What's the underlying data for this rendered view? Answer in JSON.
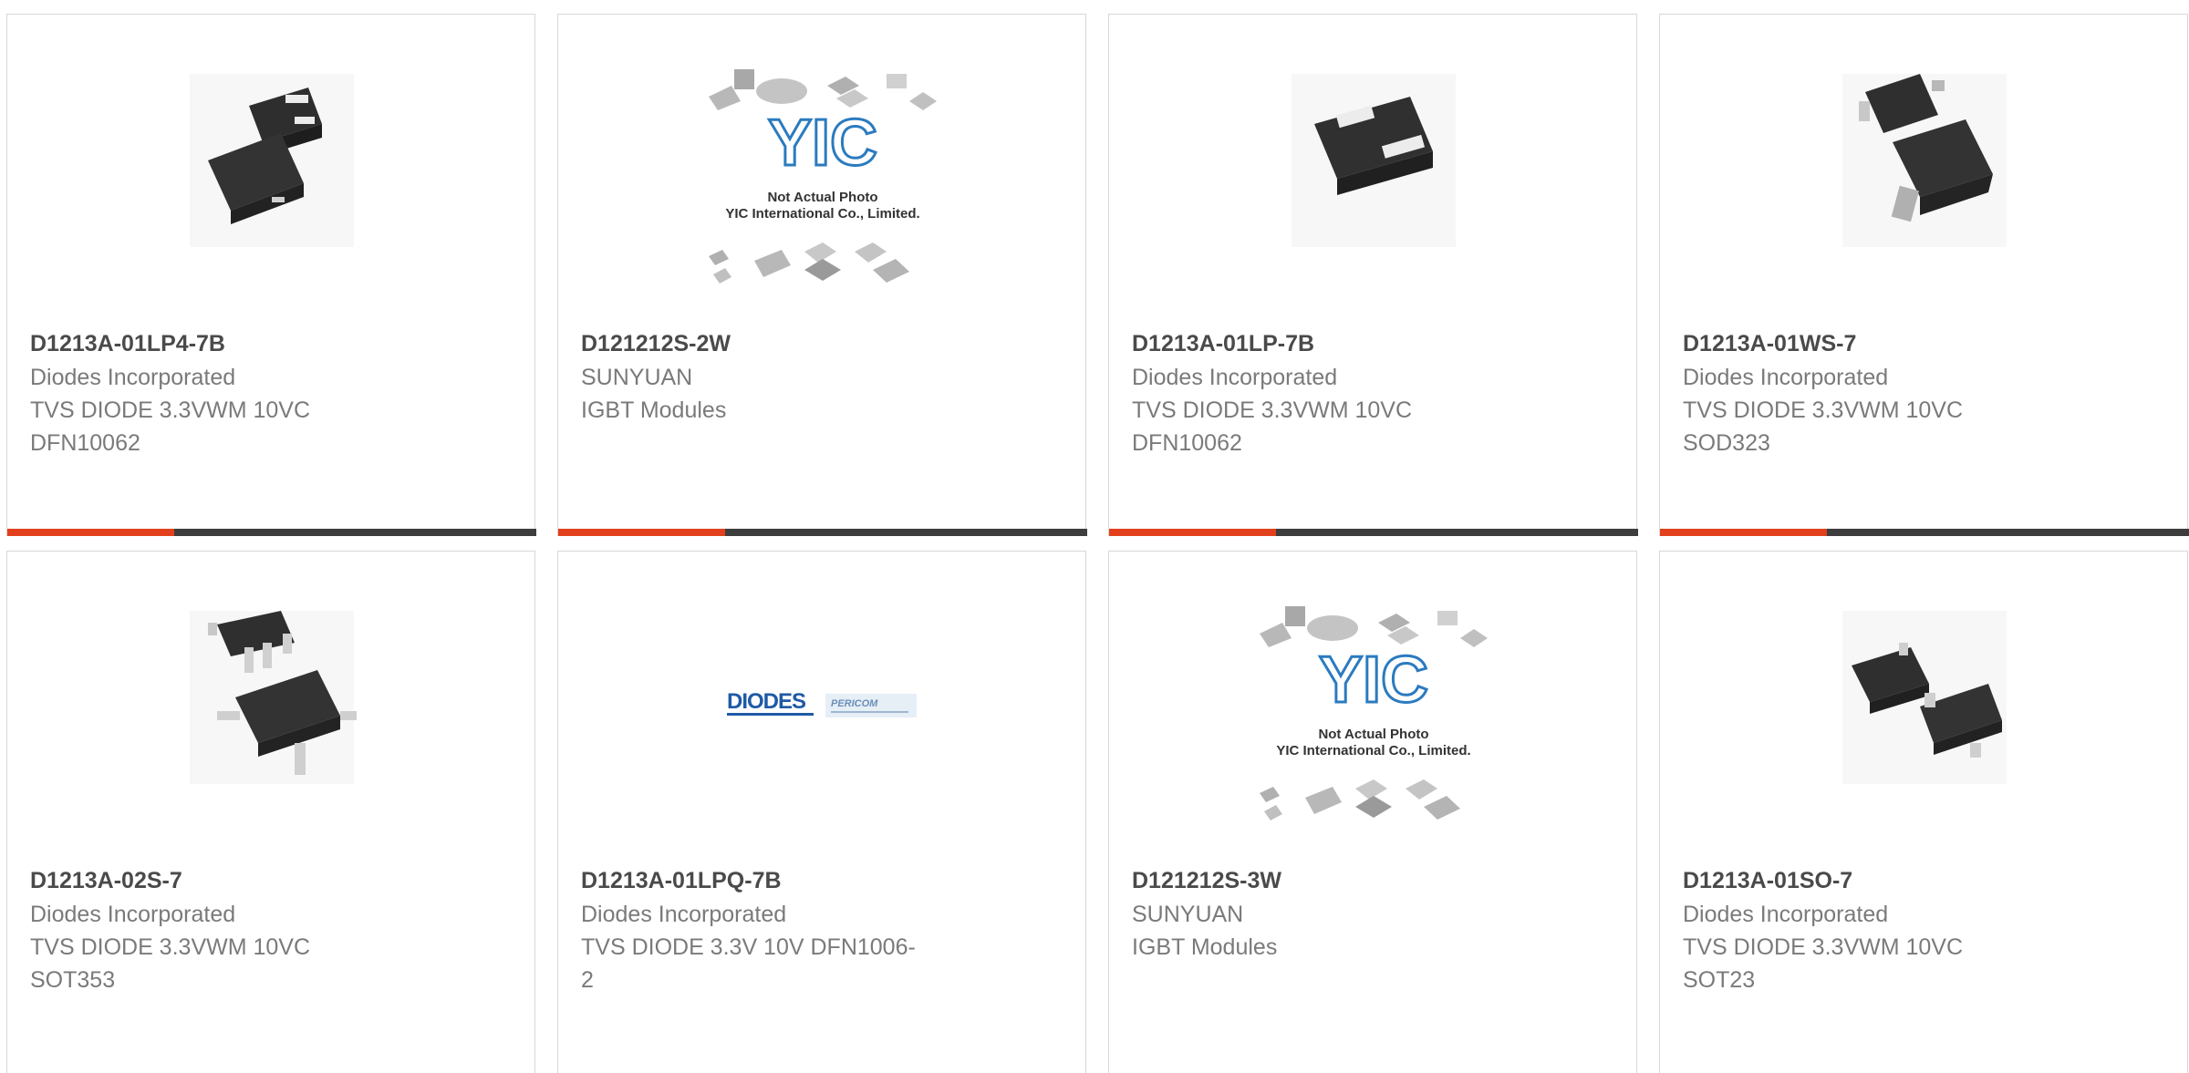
{
  "accent_color": "#e2401c",
  "products": [
    {
      "part": "D1213A-01LP4-7B",
      "lines": [
        "Diodes Incorporated",
        "TVS DIODE 3.3VWM 10VC",
        "DFN10062"
      ],
      "image": "dual-dfn-package-icon"
    },
    {
      "part": "D121212S-2W",
      "lines": [
        "SUNYUAN",
        "IGBT Modules"
      ],
      "image": "yic-placeholder-icon"
    },
    {
      "part": "D1213A-01LP-7B",
      "lines": [
        "Diodes Incorporated",
        "TVS DIODE 3.3VWM 10VC",
        "DFN10062"
      ],
      "image": "dfn-package-icon"
    },
    {
      "part": "D1213A-01WS-7",
      "lines": [
        "Diodes Incorporated",
        "TVS DIODE 3.3VWM 10VC",
        "SOD323"
      ],
      "image": "sod323-package-icon"
    },
    {
      "part": "D1213A-02S-7",
      "lines": [
        "Diodes Incorporated",
        "TVS DIODE 3.3VWM 10VC",
        "SOT353"
      ],
      "image": "sot353-package-icon"
    },
    {
      "part": "D1213A-01LPQ-7B",
      "lines": [
        "Diodes Incorporated",
        "TVS DIODE 3.3V 10V DFN1006-",
        "2"
      ],
      "image": "diodes-pericom-logo"
    },
    {
      "part": "D121212S-3W",
      "lines": [
        "SUNYUAN",
        "IGBT Modules"
      ],
      "image": "yic-placeholder-icon"
    },
    {
      "part": "D1213A-01SO-7",
      "lines": [
        "Diodes Incorporated",
        "TVS DIODE 3.3VWM 10VC",
        "SOT23"
      ],
      "image": "sot23-package-icon"
    }
  ],
  "placeholder": {
    "brand": "YIC",
    "line1": "Not Actual Photo",
    "line2": "YIC International Co., Limited."
  },
  "logo": {
    "main": "DIODES",
    "sub": "PERICOM"
  }
}
